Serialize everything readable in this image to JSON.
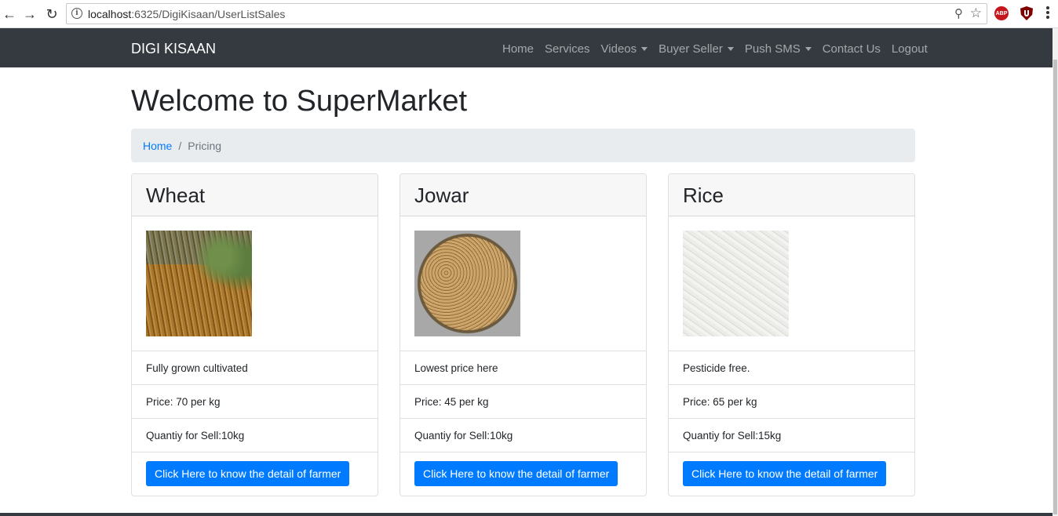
{
  "browser": {
    "url_host": "localhost",
    "url_rest": ":6325/DigiKisaan/UserListSales",
    "ext_abp_label": "ABP"
  },
  "navbar": {
    "brand": "DIGI KISAAN",
    "links": [
      {
        "label": "Home",
        "dropdown": false
      },
      {
        "label": "Services",
        "dropdown": false
      },
      {
        "label": "Videos",
        "dropdown": true
      },
      {
        "label": "Buyer Seller",
        "dropdown": true
      },
      {
        "label": "Push SMS",
        "dropdown": true
      },
      {
        "label": "Contact Us",
        "dropdown": false
      },
      {
        "label": "Logout",
        "dropdown": false
      }
    ]
  },
  "page": {
    "title": "Welcome to SuperMarket",
    "breadcrumb": {
      "home": "Home",
      "separator": "/",
      "current": "Pricing"
    }
  },
  "products": [
    {
      "name": "Wheat",
      "description": "Fully grown cultivated",
      "price": "Price: 70 per kg",
      "quantity": "Quantiy for Sell:10kg",
      "button": "Click Here to know the detail of farmer"
    },
    {
      "name": "Jowar",
      "description": "Lowest price here",
      "price": "Price: 45 per kg",
      "quantity": "Quantiy for Sell:10kg",
      "button": "Click Here to know the detail of farmer"
    },
    {
      "name": "Rice",
      "description": "Pesticide free.",
      "price": "Price: 65 per kg",
      "quantity": "Quantiy for Sell:15kg",
      "button": "Click Here to know the detail of farmer"
    }
  ],
  "colors": {
    "navbar": "#343a40",
    "primary": "#007bff",
    "breadcrumb_bg": "#e9ecef"
  }
}
